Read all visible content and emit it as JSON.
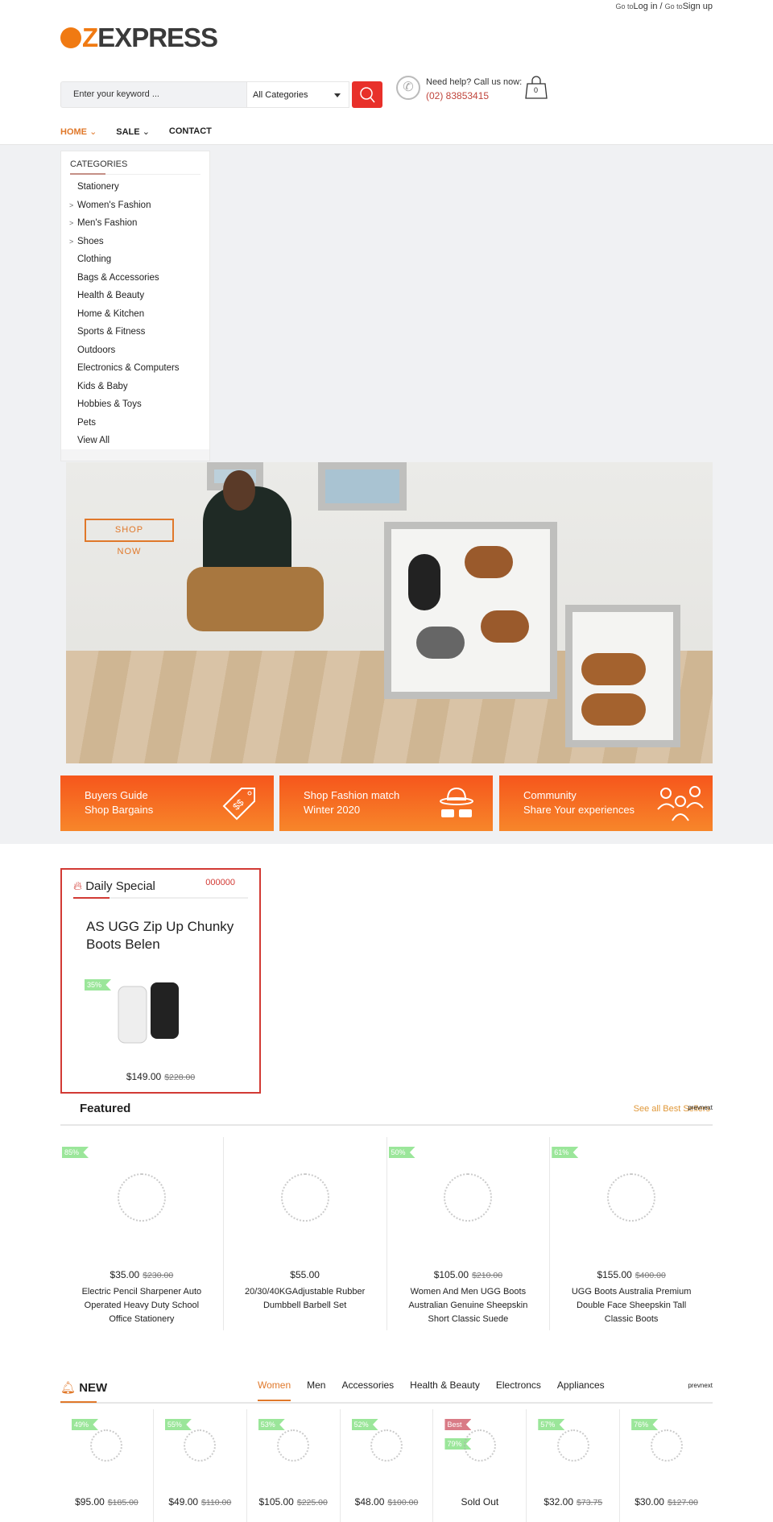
{
  "top_links": {
    "goto1": "Go to",
    "login": "Log in",
    "sep": " / ",
    "goto2": "Go to",
    "signup": "Sign up"
  },
  "logo": {
    "z": "Z",
    "rest": "EXPRESS"
  },
  "search": {
    "placeholder": "Enter your keyword ...",
    "category": "All Categories"
  },
  "help": {
    "label": "Need help? Call us now:",
    "phone": "(02) 83853415"
  },
  "cart": {
    "count": "0"
  },
  "nav": [
    {
      "label": "HOME",
      "caret": "⌄"
    },
    {
      "label": "SALE",
      "caret": "⌄"
    },
    {
      "label": "CONTACT",
      "caret": ""
    }
  ],
  "categories": {
    "title": "CATEGORIES",
    "items": [
      {
        "label": "Stationery",
        "sub": false
      },
      {
        "label": "Women's Fashion",
        "sub": true
      },
      {
        "label": "Men's Fashion",
        "sub": true
      },
      {
        "label": "Shoes",
        "sub": true
      },
      {
        "label": "Clothing",
        "sub": false
      },
      {
        "label": "Bags & Accessories",
        "sub": false
      },
      {
        "label": "Health & Beauty",
        "sub": false
      },
      {
        "label": "Home & Kitchen",
        "sub": false
      },
      {
        "label": "Sports & Fitness",
        "sub": false
      },
      {
        "label": "Outdoors",
        "sub": false
      },
      {
        "label": "Electronics & Computers",
        "sub": false
      },
      {
        "label": "Kids & Baby",
        "sub": false
      },
      {
        "label": "Hobbies & Toys",
        "sub": false
      },
      {
        "label": "Pets",
        "sub": false
      },
      {
        "label": "View All",
        "sub": false
      }
    ]
  },
  "hero": {
    "shop": "SHOP",
    "now": "NOW"
  },
  "promos": [
    {
      "l1": "Buyers Guide",
      "l2": "Shop Bargains",
      "icon": "price-tag-icon"
    },
    {
      "l1": "Shop Fashion match",
      "l2": "Winter 2020",
      "icon": "hat-glasses-icon"
    },
    {
      "l1": "Community",
      "l2": "Share Your experiences",
      "icon": "users-icon"
    }
  ],
  "daily": {
    "title": "Daily Special",
    "countdown": "000000",
    "product": "AS UGG Zip Up Chunky Boots Belen",
    "badge": "35%",
    "price": "$149.00",
    "old": "$228.00"
  },
  "featured": {
    "title": "Featured",
    "see_all": "See all Best Sellers",
    "prevnext": "prevnext",
    "products": [
      {
        "badge": "85%",
        "price": "$35.00",
        "old": "$230.00",
        "name": "Electric Pencil Sharpener Auto Operated Heavy Duty School Office Stationery"
      },
      {
        "badge": "",
        "price": "$55.00",
        "old": "",
        "name": "20/30/40KGAdjustable Rubber Dumbbell Barbell Set"
      },
      {
        "badge": "50%",
        "price": "$105.00",
        "old": "$210.00",
        "name": "Women And Men UGG Boots Australian Genuine Sheepskin Short Classic Suede"
      },
      {
        "badge": "61%",
        "price": "$155.00",
        "old": "$400.00",
        "name": "UGG Boots Australia Premium Double Face Sheepskin Tall Classic Boots"
      }
    ]
  },
  "new": {
    "title": "NEW",
    "prevnext": "prevnext",
    "tabs": [
      "Women",
      "Men",
      "Accessories",
      "Health & Beauty",
      "Electroncs",
      "Appliances"
    ],
    "products": [
      {
        "badge": "49%",
        "best": "",
        "price": "$95.00",
        "old": "$185.00"
      },
      {
        "badge": "55%",
        "best": "",
        "price": "$49.00",
        "old": "$110.00"
      },
      {
        "badge": "53%",
        "best": "",
        "price": "$105.00",
        "old": "$225.00"
      },
      {
        "badge": "52%",
        "best": "",
        "price": "$48.00",
        "old": "$100.00"
      },
      {
        "badge": "79%",
        "best": "Best",
        "price": "Sold Out",
        "old": ""
      },
      {
        "badge": "57%",
        "best": "",
        "price": "$32.00",
        "old": "$73.75"
      },
      {
        "badge": "76%",
        "best": "",
        "price": "$30.00",
        "old": "$127.00"
      }
    ]
  },
  "colors": {
    "accent": "#e0782a",
    "red": "#e8302a",
    "promo": "#f6561c",
    "badge": "#9be69a"
  }
}
